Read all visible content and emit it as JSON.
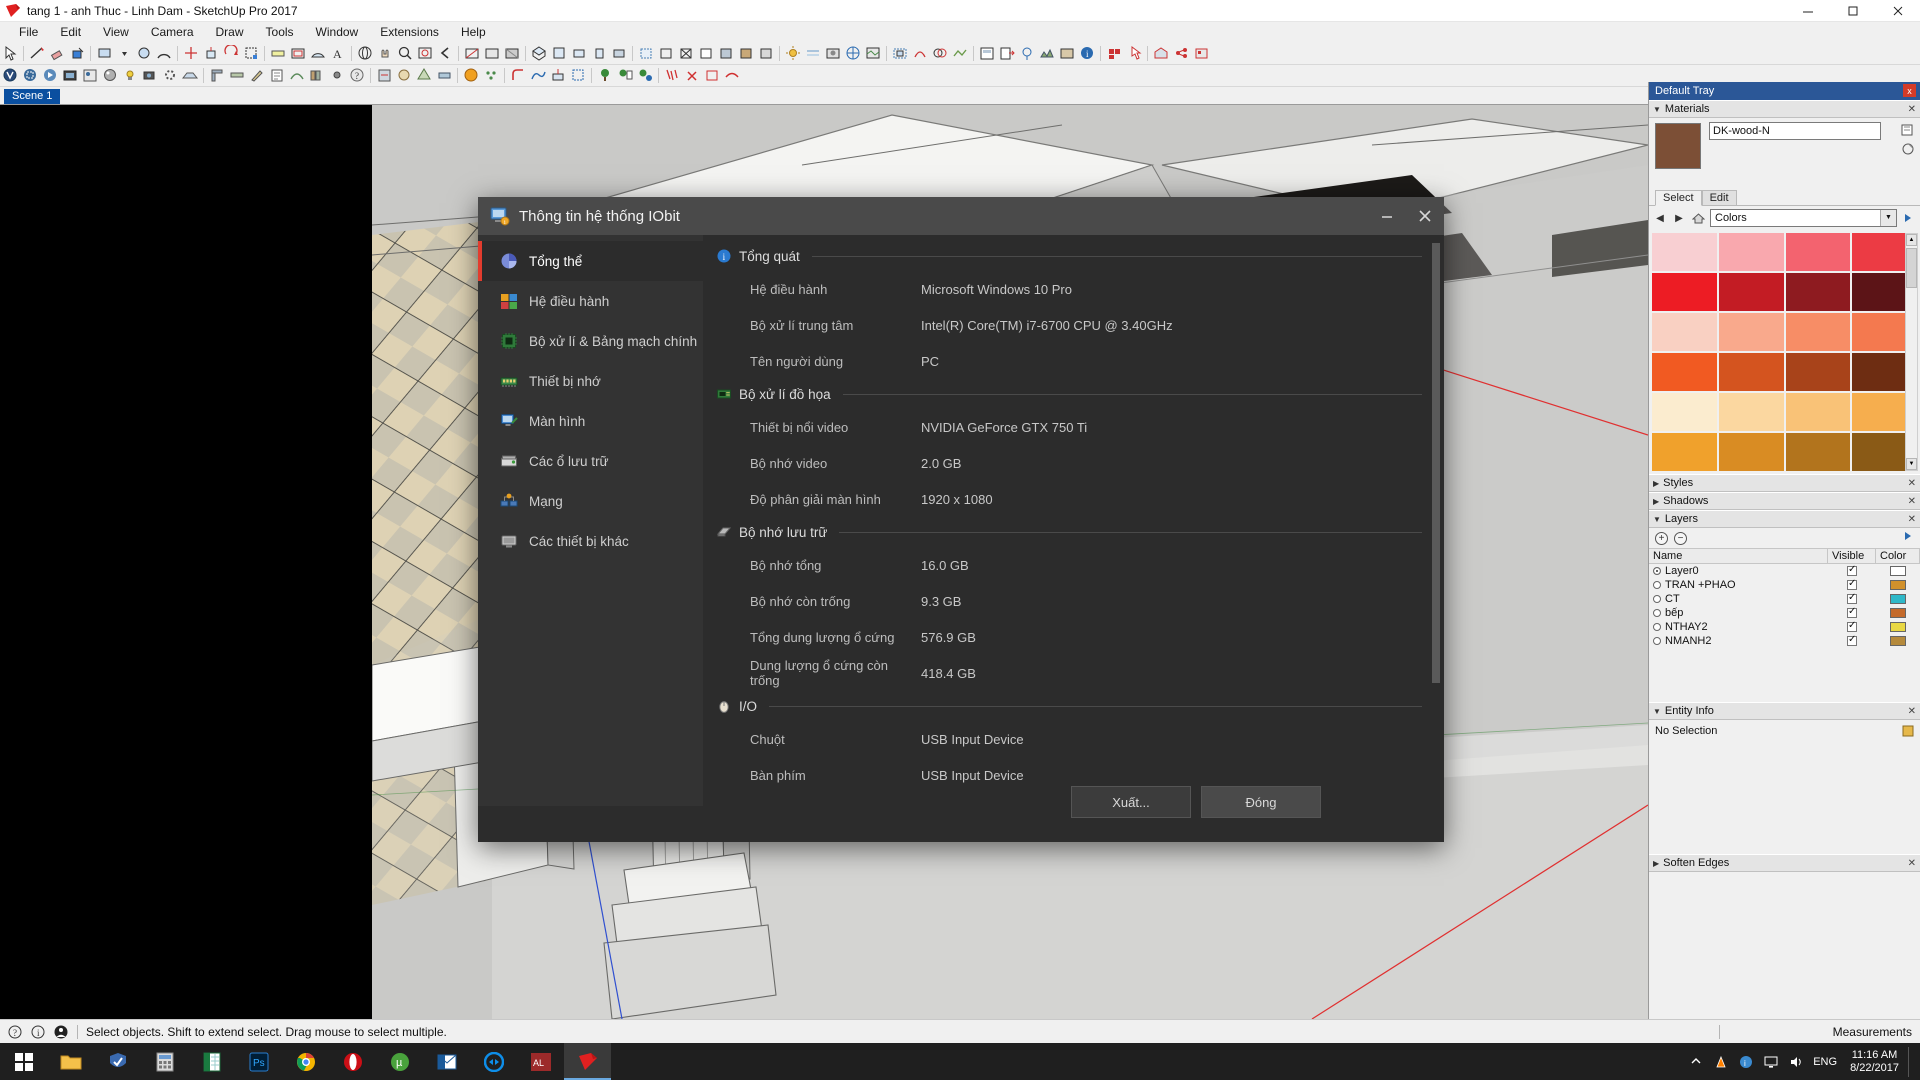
{
  "window": {
    "title": "tang 1 - anh Thuc - Linh Dam - SketchUp Pro 2017",
    "app_icon": "sketchup-logo-icon",
    "minimize": "minimize-icon",
    "maximize": "maximize-icon",
    "close": "close-icon"
  },
  "menubar": {
    "items": [
      {
        "label": "File"
      },
      {
        "label": "Edit"
      },
      {
        "label": "View"
      },
      {
        "label": "Camera"
      },
      {
        "label": "Draw"
      },
      {
        "label": "Tools"
      },
      {
        "label": "Window"
      },
      {
        "label": "Extensions"
      },
      {
        "label": "Help"
      }
    ]
  },
  "scene_tabs": {
    "items": [
      {
        "label": "Scene 1",
        "active": true
      }
    ]
  },
  "tray": {
    "title": "Default Tray",
    "close_label": "x",
    "panels": [
      {
        "name": "Materials",
        "expanded": true
      },
      {
        "name": "Styles",
        "expanded": false
      },
      {
        "name": "Shadows",
        "expanded": false
      },
      {
        "name": "Layers",
        "expanded": true
      },
      {
        "name": "Entity Info",
        "expanded": true
      },
      {
        "name": "Soften Edges",
        "expanded": false
      }
    ],
    "materials": {
      "current_name": "DK-wood-N",
      "swatch_color": "#7c4f36",
      "tabs": [
        {
          "label": "Select",
          "active": true
        },
        {
          "label": "Edit",
          "active": false
        }
      ],
      "collection": "Colors",
      "nav_icons": [
        "back-icon",
        "forward-icon",
        "home-icon"
      ],
      "side_icons": [
        "create-material-icon",
        "sample-paint-icon"
      ],
      "swatch_colors": [
        "#f8cfd2",
        "#f9a8ae",
        "#f3636f",
        "#ec3b44",
        "#ed1c24",
        "#c31c24",
        "#8e1b20",
        "#5c1417",
        "#f9d0c2",
        "#f9a98c",
        "#f78d66",
        "#f4794f",
        "#f15a22",
        "#d4541f",
        "#a8431a",
        "#6e2d12",
        "#fbeccf",
        "#fbd7a0",
        "#f9c277",
        "#f6ae4e",
        "#f0a12c",
        "#d98c23",
        "#b2741d",
        "#8a5a16"
      ]
    },
    "layers": {
      "columns": [
        "Name",
        "Visible",
        "Color"
      ],
      "add_icon": "add-layer-icon",
      "remove_icon": "remove-layer-icon",
      "details_icon": "layer-details-icon",
      "rows": [
        {
          "name": "Layer0",
          "current": true,
          "visible": true,
          "color": "#ffffff"
        },
        {
          "name": "TRAN +PHAO",
          "current": false,
          "visible": true,
          "color": "#d2912c"
        },
        {
          "name": "CT",
          "current": false,
          "visible": true,
          "color": "#2fb8c8"
        },
        {
          "name": "bếp",
          "current": false,
          "visible": true,
          "color": "#c46a2b"
        },
        {
          "name": "NTHAY2",
          "current": false,
          "visible": true,
          "color": "#e9d844"
        },
        {
          "name": "NMANH2",
          "current": false,
          "visible": true,
          "color": "#b58a3c"
        }
      ]
    },
    "entity_info": {
      "value": "No Selection",
      "icon": "entity-info-icon"
    }
  },
  "statusbar": {
    "hint_icon": "help-icon",
    "info_icon": "info-icon",
    "user_icon": "account-icon",
    "text": "Select objects. Shift to extend select. Drag mouse to select multiple.",
    "measurements_label": "Measurements"
  },
  "taskbar": {
    "start_icon": "windows-start-icon",
    "items": [
      {
        "name": "file-explorer",
        "icon": "folder-icon"
      },
      {
        "name": "windows-defender",
        "icon": "shield-icon"
      },
      {
        "name": "calculator-app",
        "icon": "calc-icon"
      },
      {
        "name": "excel-app",
        "icon": "excel-icon"
      },
      {
        "name": "photoshop-app",
        "icon": "ps-icon",
        "label": "Ps"
      },
      {
        "name": "chrome-browser",
        "icon": "chrome-icon"
      },
      {
        "name": "opera-browser",
        "icon": "opera-icon"
      },
      {
        "name": "utorrent-app",
        "icon": "utorrent-icon"
      },
      {
        "name": "outlook-app",
        "icon": "outlook-icon"
      },
      {
        "name": "teamviewer-app",
        "icon": "teamviewer-icon"
      },
      {
        "name": "autocad-app",
        "icon": "autocad-icon"
      },
      {
        "name": "sketchup-app",
        "icon": "sketchup-icon",
        "active": true
      }
    ],
    "tray_icons": [
      "show-hidden-icons-icon",
      "vlc-icon",
      "iobit-icon",
      "monitor-icon",
      "volume-icon"
    ],
    "language": "ENG",
    "time": "11:16 AM",
    "date": "8/22/2017",
    "show_desktop": "show-desktop-button"
  },
  "dialog": {
    "icon": "system-information-icon",
    "title": "Thông tin hệ thống IObit",
    "minimize": "minimize-icon",
    "close": "close-icon",
    "sidebar": [
      {
        "label": "Tổng thể",
        "icon": "overview-pie-icon",
        "active": true
      },
      {
        "label": "Hệ điều hành",
        "icon": "windows-flag-icon",
        "active": false
      },
      {
        "label": "Bộ xử lí & Bảng mạch chính",
        "icon": "cpu-chip-icon",
        "active": false
      },
      {
        "label": "Thiết bị nhớ",
        "icon": "ram-module-icon",
        "active": false
      },
      {
        "label": "Màn hình",
        "icon": "display-icon",
        "active": false
      },
      {
        "label": "Các ổ lưu trữ",
        "icon": "hard-disk-icon",
        "active": false
      },
      {
        "label": "Mạng",
        "icon": "network-icon",
        "active": false
      },
      {
        "label": "Các thiết bị khác",
        "icon": "other-devices-icon",
        "active": false
      }
    ],
    "sections": [
      {
        "title": "Tổng quát",
        "icon": "info-blue-icon",
        "rows": [
          {
            "key": "Hệ điều hành",
            "value": "Microsoft Windows 10 Pro"
          },
          {
            "key": "Bộ xử lí trung tâm",
            "value": "Intel(R) Core(TM) i7-6700 CPU @ 3.40GHz"
          },
          {
            "key": "Tên người dùng",
            "value": "PC"
          }
        ]
      },
      {
        "title": "Bộ xử lí đồ họa",
        "icon": "gpu-chip-icon",
        "rows": [
          {
            "key": "Thiết bị nổi video",
            "value": "NVIDIA GeForce GTX 750 Ti"
          },
          {
            "key": "Bộ nhớ video",
            "value": "2.0 GB"
          },
          {
            "key": "Độ phân giải màn hình",
            "value": "1920 x 1080"
          }
        ]
      },
      {
        "title": "Bộ nhớ lưu trữ",
        "icon": "memory-chip-icon",
        "rows": [
          {
            "key": "Bộ nhớ tổng",
            "value": "16.0 GB"
          },
          {
            "key": "Bộ nhớ còn trống",
            "value": "9.3 GB"
          },
          {
            "key": "Tổng dung lượng ổ cứng",
            "value": "576.9 GB"
          },
          {
            "key": "Dung lượng ổ cứng còn trống",
            "value": "418.4 GB"
          }
        ]
      },
      {
        "title": "I/O",
        "icon": "io-mouse-icon",
        "rows": [
          {
            "key": "Chuột",
            "value": "USB Input Device"
          },
          {
            "key": "Bàn phím",
            "value": "USB Input Device"
          }
        ]
      }
    ],
    "footer": {
      "export_label": "Xuất...",
      "close_label": "Đóng"
    },
    "accent_color": "#e23c2e"
  }
}
